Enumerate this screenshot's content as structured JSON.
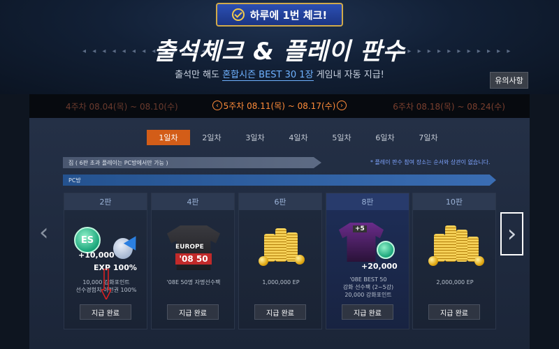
{
  "header": {
    "daily_badge": "하루에 1번 체크!",
    "title": "출석체크 & 플레이 판수",
    "subtitle_prefix": "출석만 해도 ",
    "subtitle_highlight": "혼합시즌 BEST 30 1장",
    "subtitle_suffix": " 게임내 자동 지급!",
    "notice_button": "유의사항"
  },
  "weeks": {
    "prev": "4주차 08.04(목) ~ 08.10(수)",
    "current": "5주차 08.11(목) ~ 08.17(수)",
    "next": "6주차 08.18(목) ~ 08.24(수)"
  },
  "day_tabs": [
    "1일차",
    "2일차",
    "3일차",
    "4일차",
    "5일차",
    "6일차",
    "7일차"
  ],
  "active_day": "1일차",
  "bars": {
    "pc_only": "집 ( 6판 초과 플레이는 PC방에서만 가능 )",
    "pc": "PC방",
    "side_note": "* 플레이 판수 참여 장소는 순서와 상관이 없습니다."
  },
  "cards": [
    {
      "games": "2판",
      "art_line1": "+10,000",
      "art_line2": "EXP 100%",
      "desc_line1": "10,000 강화포인트",
      "desc_line2": "선수경험치 이전권 100%",
      "desc_line3": "",
      "button": "지급 완료"
    },
    {
      "games": "4판",
      "art_line1": "EUROPE",
      "art_line2": "'08 50",
      "desc_line1": "'08E 50명 자명선수팩",
      "desc_line2": "",
      "desc_line3": "",
      "button": "지급 완료"
    },
    {
      "games": "6판",
      "art_line1": "",
      "art_line2": "",
      "desc_line1": "1,000,000 EP",
      "desc_line2": "",
      "desc_line3": "",
      "button": "지급 완료"
    },
    {
      "games": "8판",
      "art_line1": "+5",
      "art_line2": "+20,000",
      "desc_line1": "'08E BEST 50",
      "desc_line2": "강화 선수팩 (2~5강)",
      "desc_line3": "20,000 강화포인트",
      "button": "지급 완료"
    },
    {
      "games": "10판",
      "art_line1": "",
      "art_line2": "",
      "desc_line1": "2,000,000 EP",
      "desc_line2": "",
      "desc_line3": "",
      "button": "지급 완료"
    }
  ],
  "colors": {
    "accent": "#d35d18",
    "week_current": "#ff8c3a",
    "highlight_text": "#6fb2ff"
  }
}
